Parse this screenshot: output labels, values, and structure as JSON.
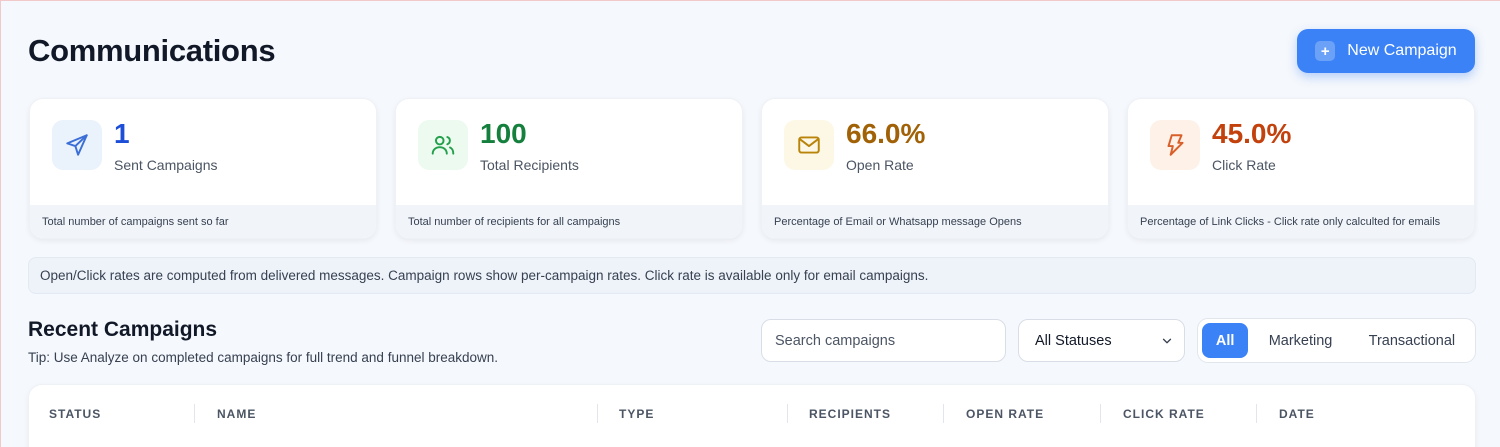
{
  "header": {
    "title": "Communications",
    "new_campaign_label": "New Campaign",
    "new_campaign_icon": "plus-icon"
  },
  "stats": [
    {
      "value": "1",
      "label": "Sent Campaigns",
      "footnote": "Total number of campaigns sent so far",
      "icon": "send-icon",
      "accent": "#1d4ed8",
      "icon_bg": "#eaf2fc",
      "icon_color": "#3b6fd6"
    },
    {
      "value": "100",
      "label": "Total Recipients",
      "footnote": "Total number of recipients for all campaigns",
      "icon": "users-icon",
      "accent": "#15803d",
      "icon_bg": "#ecfaf0",
      "icon_color": "#22a04b"
    },
    {
      "value": "66.0%",
      "label": "Open Rate",
      "footnote": "Percentage of Email or Whatsapp message Opens",
      "icon": "mail-icon",
      "accent": "#a16207",
      "icon_bg": "#fdf8e6",
      "icon_color": "#b9840a"
    },
    {
      "value": "45.0%",
      "label": "Click Rate",
      "footnote": "Percentage of Link Clicks - Click rate only calculted for emails",
      "icon": "pointer-icon",
      "accent": "#c2410c",
      "icon_bg": "#fdf1e8",
      "icon_color": "#d9602a"
    }
  ],
  "info_text": "Open/Click rates are computed from delivered messages. Campaign rows show per-campaign rates. Click rate is available only for email campaigns.",
  "recent": {
    "title": "Recent Campaigns",
    "tip": "Tip: Use Analyze on completed campaigns for full trend and funnel breakdown.",
    "search_placeholder": "Search campaigns",
    "status_selected": "All Statuses",
    "filters": [
      "All",
      "Marketing",
      "Transactional"
    ],
    "active_filter": "All"
  },
  "table": {
    "columns": [
      "STATUS",
      "NAME",
      "TYPE",
      "RECIPIENTS",
      "OPEN RATE",
      "CLICK RATE",
      "DATE"
    ]
  },
  "colors": {
    "primary": "#3b82f6",
    "background": "#f5f8fc"
  }
}
